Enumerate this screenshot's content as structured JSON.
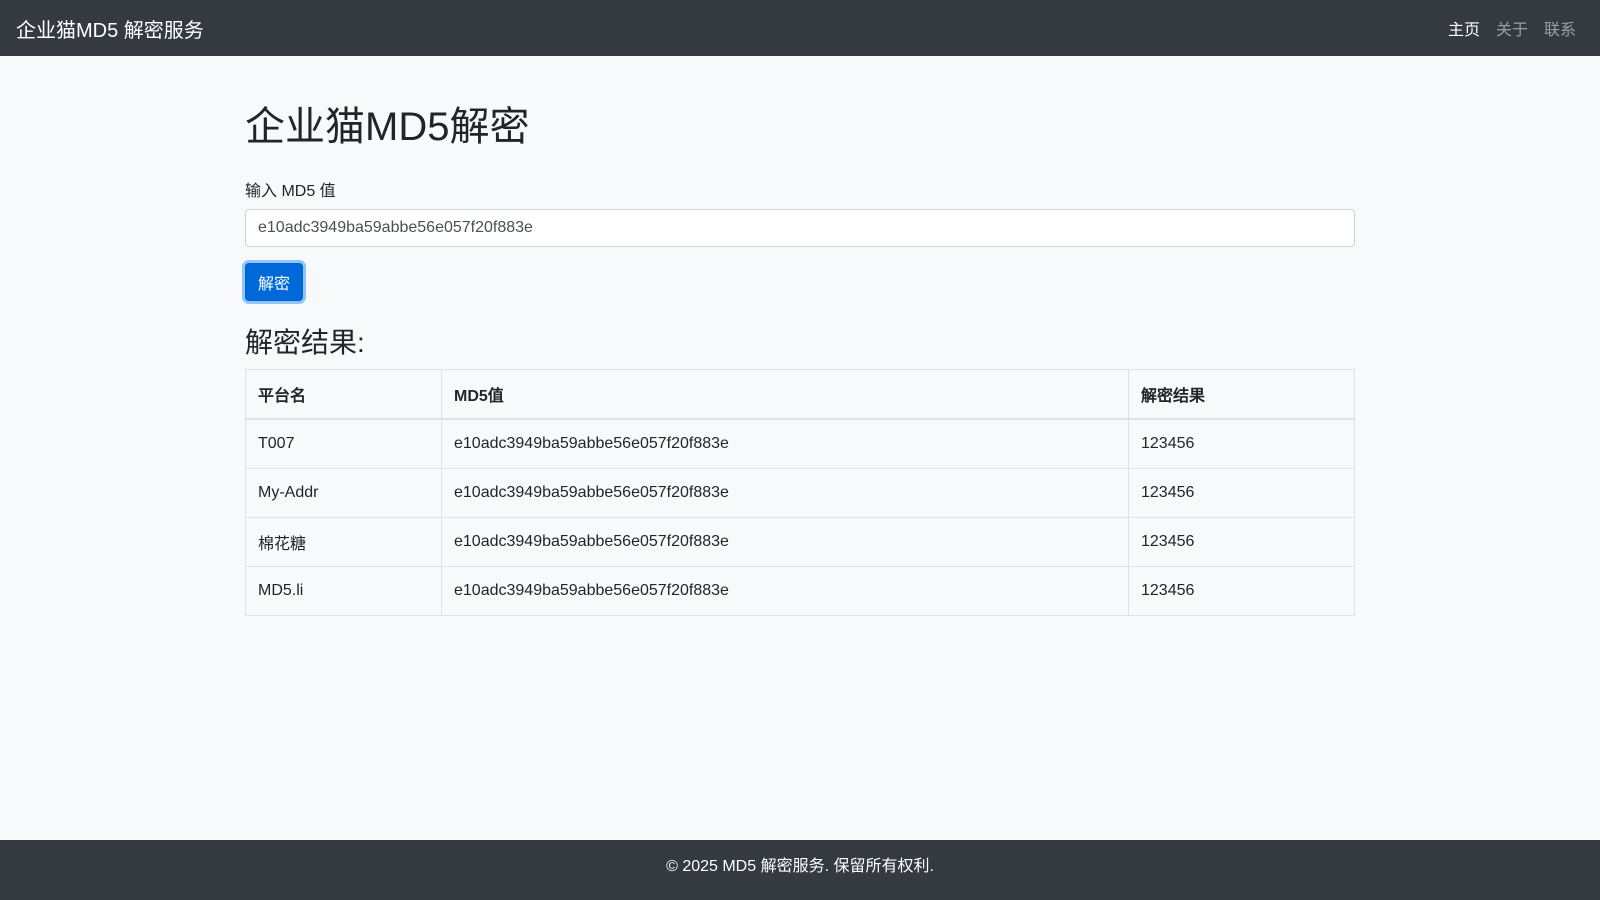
{
  "navbar": {
    "brand": "企业猫MD5 解密服务",
    "items": [
      "主页",
      "关于",
      "联系"
    ]
  },
  "main": {
    "title": "企业猫MD5解密",
    "input_label": "输入 MD5 值",
    "input_value": "e10adc3949ba59abbe56e057f20f883e",
    "button": "解密",
    "results_title": "解密结果:",
    "table": {
      "headers": [
        "平台名",
        "MD5值",
        "解密结果"
      ],
      "rows": [
        [
          "T007",
          "e10adc3949ba59abbe56e057f20f883e",
          "123456"
        ],
        [
          "My-Addr",
          "e10adc3949ba59abbe56e057f20f883e",
          "123456"
        ],
        [
          "棉花糖",
          "e10adc3949ba59abbe56e057f20f883e",
          "123456"
        ],
        [
          "MD5.li",
          "e10adc3949ba59abbe56e057f20f883e",
          "123456"
        ]
      ]
    }
  },
  "footer": {
    "text": "© 2025 MD5 解密服务. 保留所有权利."
  }
}
